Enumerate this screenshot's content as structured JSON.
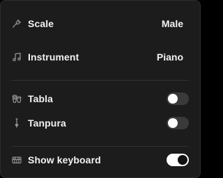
{
  "settings": {
    "scale": {
      "label": "Scale",
      "value": "Male",
      "icon": "tuning-fork-icon"
    },
    "instrument": {
      "label": "Instrument",
      "value": "Piano",
      "icon": "music-note-icon"
    },
    "tabla": {
      "label": "Tabla",
      "enabled": false,
      "icon": "tabla-icon"
    },
    "tanpura": {
      "label": "Tanpura",
      "enabled": false,
      "icon": "tanpura-icon"
    },
    "show_keyboard": {
      "label": "Show keyboard",
      "enabled": true,
      "icon": "piano-keyboard-icon"
    }
  },
  "colors": {
    "panel_background": "#1c1c1c",
    "toggle_off": "#3a3a3a",
    "toggle_on": "#ffffff",
    "text": "#f2f2f2"
  }
}
